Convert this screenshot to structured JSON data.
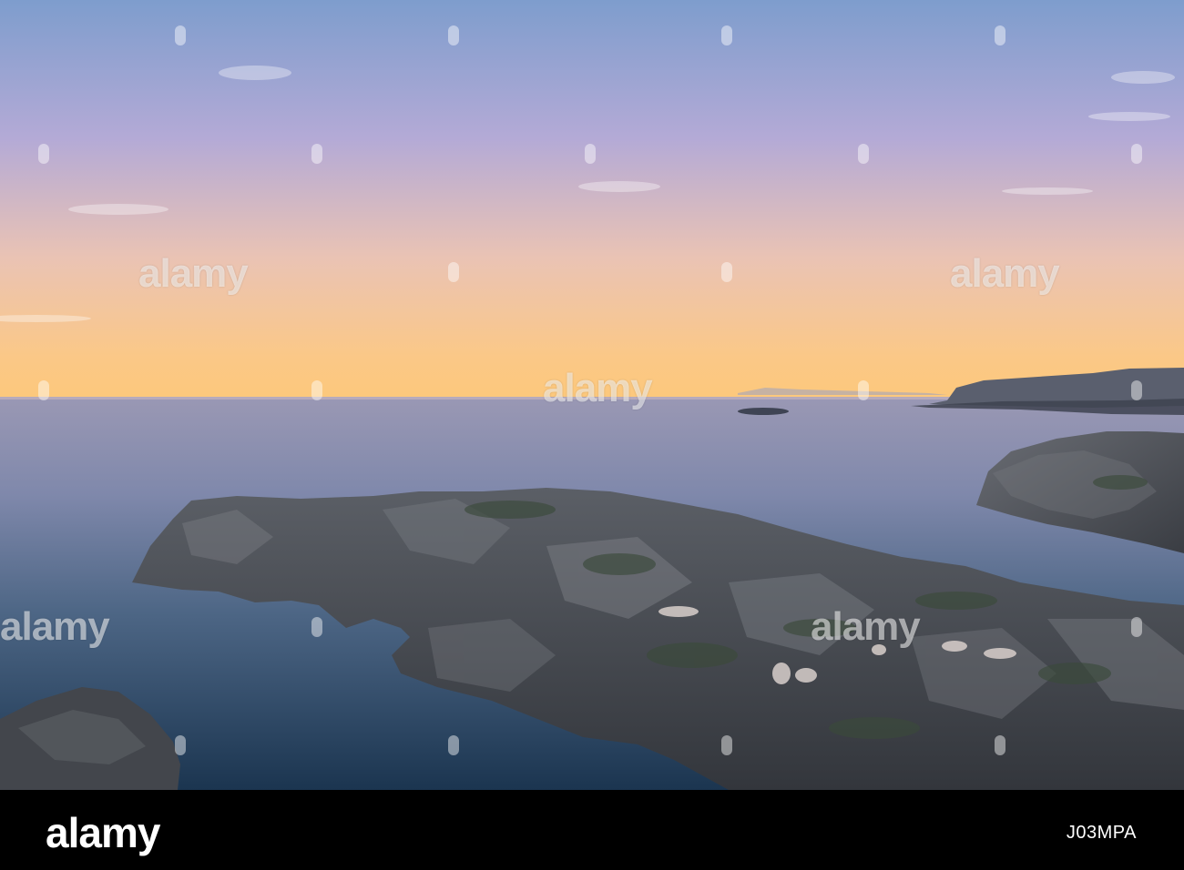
{
  "watermark": {
    "text": "alamy",
    "color": "#ffffff"
  },
  "footer": {
    "logo": "alamy",
    "image_id": "J03MPA",
    "background": "#000000"
  },
  "scene": {
    "sky_colors": [
      "#7f9dcc",
      "#b8a9d4",
      "#f0c4a8",
      "#fcc880"
    ],
    "sea_colors": [
      "#8f95b6",
      "#5a7394",
      "#1f3b57"
    ],
    "rock_color": "#4a4e55"
  }
}
